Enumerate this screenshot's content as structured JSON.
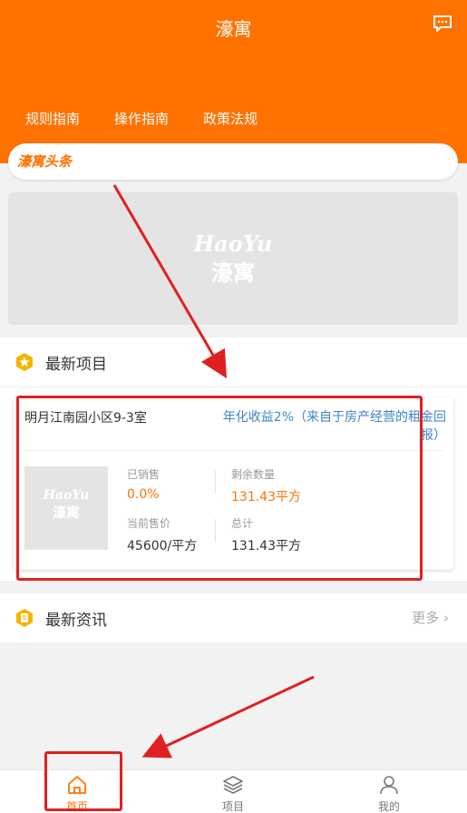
{
  "header": {
    "title": "濠寓",
    "message_icon": "chat-icon",
    "nav_links": [
      "规则指南",
      "操作指南",
      "政策法规"
    ],
    "bg_color": "#ff7200"
  },
  "news_bar": {
    "logo_text": "濠寓头条"
  },
  "banner": {
    "logo_en": "HaoYu",
    "logo_cn": "濠寓"
  },
  "latest_projects": {
    "title": "最新项目",
    "card": {
      "name": "明月江南园小区9-3室",
      "yield_text": "年化收益2%（来自于房产经营的租金回报）",
      "thumb_logo_en": "HaoYu",
      "thumb_logo_cn": "濠寓",
      "sold_label": "已销售",
      "sold_value": "0.0%",
      "remaining_label": "剩余数量",
      "remaining_value": "131.43平方",
      "price_label": "当前售价",
      "price_value": "45600/平方",
      "total_label": "总计",
      "total_value": "131.43平方"
    }
  },
  "latest_news": {
    "title": "最新资讯",
    "more_label": "更多"
  },
  "tabbar": {
    "tabs": [
      {
        "label": "首页",
        "icon": "home-icon",
        "active": true
      },
      {
        "label": "项目",
        "icon": "layers-icon",
        "active": false
      },
      {
        "label": "我的",
        "icon": "user-icon",
        "active": false
      }
    ]
  },
  "colors": {
    "accent": "#ff7200",
    "link_blue": "#3d85c6",
    "annotation_red": "#e02020"
  }
}
